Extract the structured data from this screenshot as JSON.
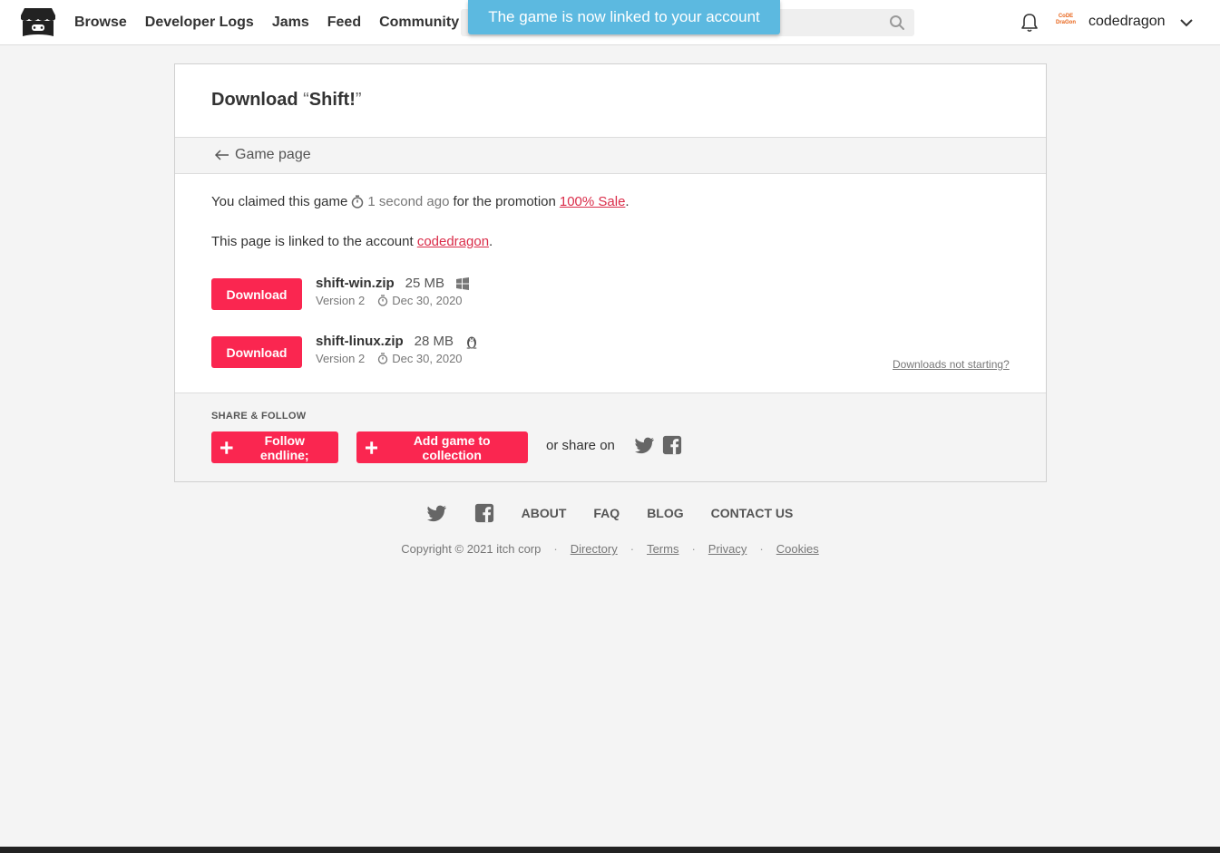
{
  "header": {
    "nav": [
      "Browse",
      "Developer Logs",
      "Jams",
      "Feed",
      "Community"
    ],
    "search_placeholder": "",
    "toast": "The game is now linked to your account",
    "username": "codedragon",
    "avatar_text": "CoDE DraGon"
  },
  "card": {
    "title_prefix": "Download ",
    "open_quote": "“",
    "game_name": "Shift!",
    "close_quote": "”",
    "back_label": "Game page",
    "claim_prefix": "You claimed this game",
    "claim_time": "1 second ago",
    "claim_middle": "for the promotion",
    "promotion": "100% Sale",
    "claim_suffix": ".",
    "linked_prefix": "This page is linked to the account",
    "linked_account": "codedragon",
    "linked_suffix": ".",
    "downloads": [
      {
        "button": "Download",
        "name": "shift-win.zip",
        "size": "25 MB",
        "os": "windows-icon",
        "version": "Version 2",
        "date": "Dec 30, 2020"
      },
      {
        "button": "Download",
        "name": "shift-linux.zip",
        "size": "28 MB",
        "os": "linux-icon",
        "version": "Version 2",
        "date": "Dec 30, 2020"
      }
    ],
    "not_starting": "Downloads not starting?",
    "share_title": "SHARE & FOLLOW",
    "follow_label": "Follow endline;",
    "collection_label": "Add game to collection",
    "share_on": "or share on"
  },
  "footer": {
    "links": [
      "ABOUT",
      "FAQ",
      "BLOG",
      "CONTACT US"
    ],
    "copyright": "Copyright © 2021 itch corp",
    "legal": [
      "Directory",
      "Terms",
      "Privacy",
      "Cookies"
    ]
  },
  "colors": {
    "accent": "#fa2650",
    "link": "#da2c49",
    "toast": "#5cb9e0",
    "background": "#f4f4f4"
  }
}
